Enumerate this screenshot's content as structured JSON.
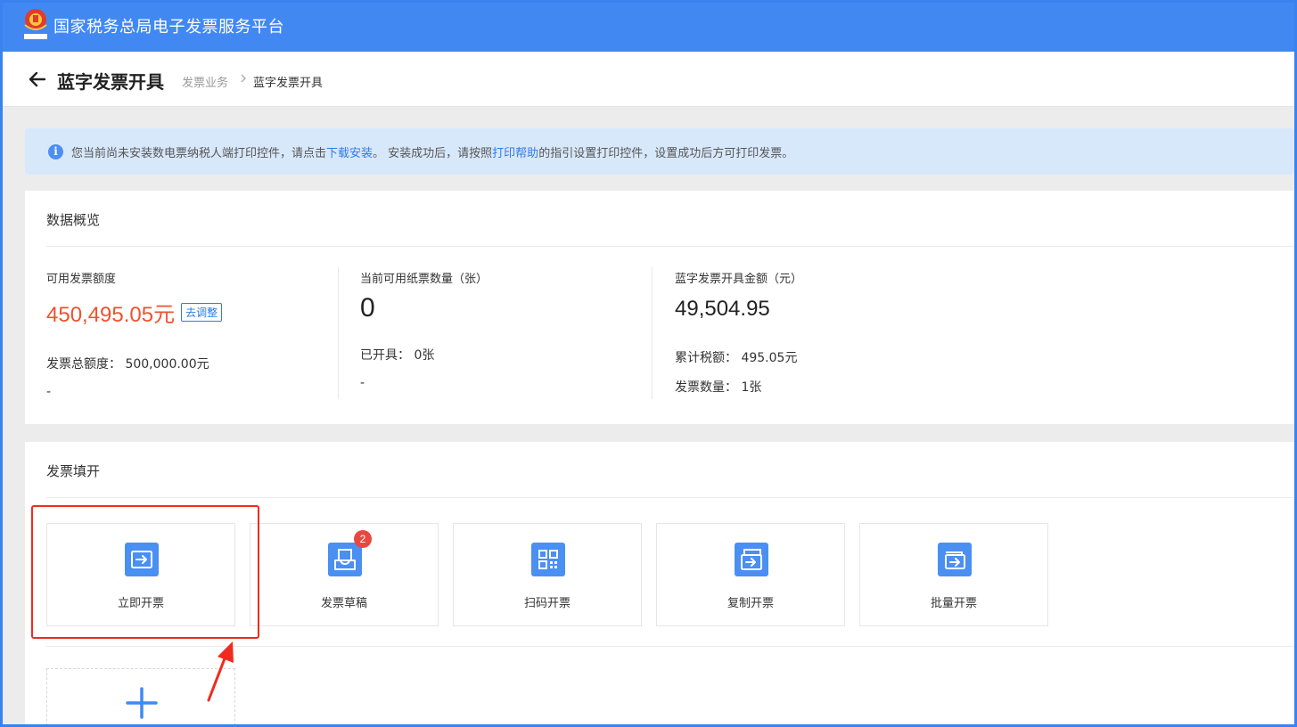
{
  "app": {
    "title": "国家税务总局电子发票服务平台",
    "emblem_text": "全国税务",
    "brand_color": "#4288f3"
  },
  "header": {
    "back_icon": "arrow-left-icon",
    "title": "蓝字发票开具",
    "breadcrumb": {
      "parent": "发票业务",
      "separator": ">",
      "current": "蓝字发票开具"
    }
  },
  "notice": {
    "icon": "info-icon",
    "icon_glyph": "i",
    "text_1": "您当前尚未安装数电票纳税人端打印控件，请点击",
    "link_1": "下载安装",
    "text_2": "。 安装成功后，请按照",
    "link_2": "打印帮助",
    "text_3": "的指引设置打印控件，设置成功后方可打印发票。"
  },
  "overview": {
    "title": "数据概览",
    "available_quota": {
      "label": "可用发票额度",
      "value": "450,495.05元",
      "adjust_label": "去调整",
      "total_label": "发票总额度：",
      "total_value": "500,000.00元",
      "extra": "-"
    },
    "paper_invoices": {
      "label": "当前可用纸票数量（张）",
      "value": "0",
      "issued_label": "已开具：",
      "issued_value": "0张",
      "extra": "-"
    },
    "blue_amount": {
      "label": "蓝字发票开具金额（元）",
      "value": "49,504.95",
      "tax_label": "累计税额：",
      "tax_value": "495.05元",
      "count_label": "发票数量：",
      "count_value": "1张"
    }
  },
  "fill": {
    "title": "发票填开",
    "tiles": [
      {
        "label": "立即开票",
        "icon": "issue-invoice-icon"
      },
      {
        "label": "发票草稿",
        "icon": "draft-tray-icon",
        "badge": "2"
      },
      {
        "label": "扫码开票",
        "icon": "qr-code-icon"
      },
      {
        "label": "复制开票",
        "icon": "copy-invoice-icon"
      },
      {
        "label": "批量开票",
        "icon": "batch-invoice-icon"
      }
    ],
    "add_icon": "plus-icon"
  },
  "annotation": {
    "highlight_color": "#f22a1d"
  }
}
